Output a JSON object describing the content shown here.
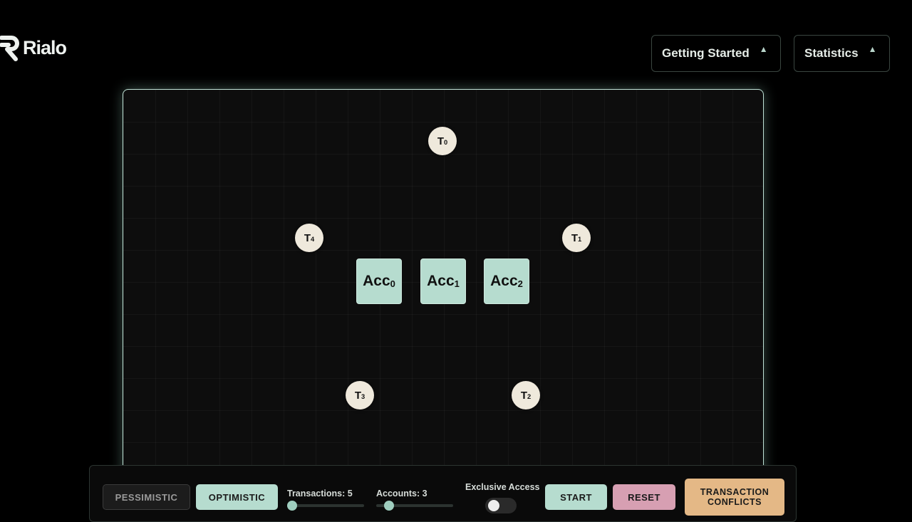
{
  "brand": {
    "name": "Rialo"
  },
  "header": {
    "getting_started": "Getting Started",
    "statistics": "Statistics",
    "expand_icon": "▲"
  },
  "diagram": {
    "transactions": [
      {
        "label": "T",
        "index": "0"
      },
      {
        "label": "T",
        "index": "1"
      },
      {
        "label": "T",
        "index": "2"
      },
      {
        "label": "T",
        "index": "3"
      },
      {
        "label": "T",
        "index": "4"
      }
    ],
    "accounts": [
      {
        "label": "Acc",
        "index": "0"
      },
      {
        "label": "Acc",
        "index": "1"
      },
      {
        "label": "Acc",
        "index": "2"
      }
    ]
  },
  "controls": {
    "pessimistic": "PESSIMISTIC",
    "optimistic": "OPTIMISTIC",
    "mode_selected": "optimistic",
    "transactions_label": "Transactions: 5",
    "transactions_value": 5,
    "accounts_label": "Accounts: 3",
    "accounts_value": 3,
    "exclusive_access_label": "Exclusive Access",
    "exclusive_access_on": false,
    "start": "START",
    "reset": "RESET",
    "conflicts_line1": "TRANSACTION",
    "conflicts_line2": "CONFLICTS"
  },
  "colors": {
    "background": "#000000",
    "accent_mint": "#b6dccf",
    "reset_pink": "#d79fb2",
    "conflicts_gold": "#e4b886",
    "node_cream": "#efe9dc"
  }
}
